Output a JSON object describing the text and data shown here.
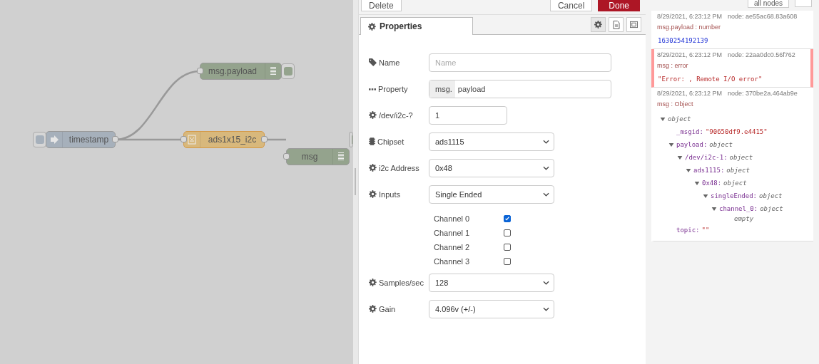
{
  "canvas": {
    "nodes": [
      {
        "label": "timestamp",
        "kind": "inject"
      },
      {
        "label": "msg.payload",
        "kind": "debug"
      },
      {
        "label": "ads1x15_i2c",
        "kind": "function"
      },
      {
        "label": "msg",
        "kind": "debug"
      }
    ]
  },
  "editor": {
    "buttons": [
      {
        "label": "Delete",
        "kind": "plain"
      },
      {
        "label": "Cancel",
        "kind": "plain"
      },
      {
        "label": "Done",
        "kind": "primary"
      }
    ],
    "tab": {
      "label": "Properties",
      "selected": true
    },
    "fields": [
      {
        "label": "Name",
        "kind": "text",
        "placeholder": "Name"
      },
      {
        "label": "Property",
        "kind": "typed",
        "prefix": "msg.",
        "value": "payload"
      },
      {
        "label": "/dev/i2c-?",
        "kind": "short",
        "value": "1"
      },
      {
        "label": "Chipset",
        "kind": "select",
        "value": "ads1115"
      },
      {
        "label": "i2c Address",
        "kind": "select",
        "value": "0x48"
      },
      {
        "label": "Inputs",
        "kind": "select",
        "value": "Single Ended"
      },
      {
        "kind": "channels",
        "channels": [
          {
            "label": "Channel 0",
            "checked": true
          },
          {
            "label": "Channel 1",
            "checked": false
          },
          {
            "label": "Channel 2",
            "checked": false
          },
          {
            "label": "Channel 3",
            "checked": false
          }
        ]
      },
      {
        "label": "Samples/sec",
        "kind": "select",
        "value": "128"
      },
      {
        "label": "Gain",
        "kind": "select",
        "value": "4.096v (+/-)"
      }
    ]
  },
  "debug": {
    "filter": "all nodes",
    "messages": [
      {
        "time": "8/29/2021, 6:23:12 PM",
        "node": "node: ae55ac68.83a608",
        "topic": "msg.payload : number",
        "error": false,
        "kind": "number",
        "value": "1630254192139"
      },
      {
        "time": "8/29/2021, 6:23:12 PM",
        "node": "node: 22aa0dc0.56f762",
        "topic": "msg : error",
        "error": true,
        "kind": "string",
        "value": "\"Error: , Remote I/O error\""
      },
      {
        "time": "8/29/2021, 6:23:12 PM",
        "node": "node: 370be2a.464ab9e",
        "topic": "msg : Object",
        "error": false,
        "kind": "object",
        "tree": {
          "value": "object",
          "kind": "object",
          "expanded": true,
          "children": [
            {
              "key": "_msgid:",
              "value": "\"90650df9.e4415\"",
              "kind": "string"
            },
            {
              "key": "payload:",
              "value": "object",
              "kind": "object",
              "expanded": true,
              "children": [
                {
                  "key": "/dev/i2c-1:",
                  "value": "object",
                  "kind": "object",
                  "expanded": true,
                  "children": [
                    {
                      "key": "ads1115:",
                      "value": "object",
                      "kind": "object",
                      "expanded": true,
                      "children": [
                        {
                          "key": "0x48:",
                          "value": "object",
                          "kind": "object",
                          "expanded": true,
                          "children": [
                            {
                              "key": "singleEnded:",
                              "value": "object",
                              "kind": "object",
                              "expanded": true,
                              "children": [
                                {
                                  "key": "channel_0:",
                                  "value": "object",
                                  "kind": "object",
                                  "expanded": true,
                                  "note": "empty"
                                }
                              ]
                            }
                          ]
                        }
                      ]
                    }
                  ]
                }
              ]
            },
            {
              "key": "topic:",
              "value": "\"\"",
              "kind": "string"
            }
          ]
        }
      }
    ]
  }
}
